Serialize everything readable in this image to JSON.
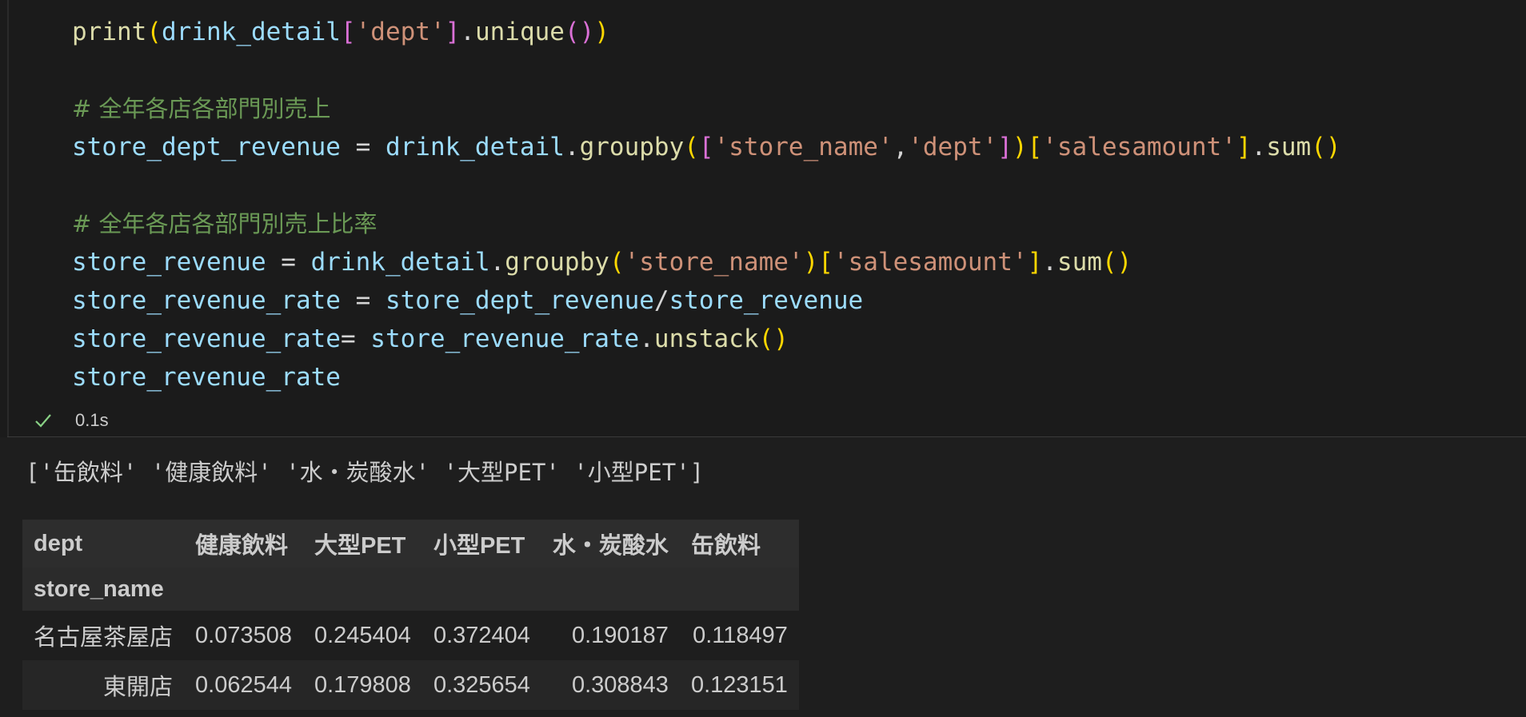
{
  "code_cell": {
    "lines": [
      {
        "segments": [
          [
            "fn",
            "print"
          ],
          [
            "b1",
            "("
          ],
          [
            "var",
            "drink_detail"
          ],
          [
            "b2",
            "["
          ],
          [
            "str",
            "'dept'"
          ],
          [
            "b2",
            "]"
          ],
          [
            "op",
            "."
          ],
          [
            "fn",
            "unique"
          ],
          [
            "b2",
            "()"
          ],
          [
            "b1",
            ")"
          ]
        ]
      },
      {
        "segments": []
      },
      {
        "segments": [
          [
            "cmt",
            "# 全年各店各部門別売上"
          ]
        ]
      },
      {
        "segments": [
          [
            "var",
            "store_dept_revenue"
          ],
          [
            "op",
            " = "
          ],
          [
            "var",
            "drink_detail"
          ],
          [
            "op",
            "."
          ],
          [
            "fn",
            "groupby"
          ],
          [
            "b1",
            "("
          ],
          [
            "b2",
            "["
          ],
          [
            "str",
            "'store_name'"
          ],
          [
            "op",
            ","
          ],
          [
            "str",
            "'dept'"
          ],
          [
            "b2",
            "]"
          ],
          [
            "b1",
            ")"
          ],
          [
            "b1",
            "["
          ],
          [
            "str",
            "'salesamount'"
          ],
          [
            "b1",
            "]"
          ],
          [
            "op",
            "."
          ],
          [
            "fn",
            "sum"
          ],
          [
            "b1",
            "()"
          ]
        ]
      },
      {
        "segments": []
      },
      {
        "segments": [
          [
            "cmt",
            "# 全年各店各部門別売上比率"
          ]
        ]
      },
      {
        "segments": [
          [
            "var",
            "store_revenue"
          ],
          [
            "op",
            " = "
          ],
          [
            "var",
            "drink_detail"
          ],
          [
            "op",
            "."
          ],
          [
            "fn",
            "groupby"
          ],
          [
            "b1",
            "("
          ],
          [
            "str",
            "'store_name'"
          ],
          [
            "b1",
            ")"
          ],
          [
            "b1",
            "["
          ],
          [
            "str",
            "'salesamount'"
          ],
          [
            "b1",
            "]"
          ],
          [
            "op",
            "."
          ],
          [
            "fn",
            "sum"
          ],
          [
            "b1",
            "()"
          ]
        ]
      },
      {
        "segments": [
          [
            "var",
            "store_revenue_rate"
          ],
          [
            "op",
            " = "
          ],
          [
            "var",
            "store_dept_revenue"
          ],
          [
            "op",
            "/"
          ],
          [
            "var",
            "store_revenue"
          ]
        ]
      },
      {
        "segments": [
          [
            "var",
            "store_revenue_rate"
          ],
          [
            "op",
            "= "
          ],
          [
            "var",
            "store_revenue_rate"
          ],
          [
            "op",
            "."
          ],
          [
            "fn",
            "unstack"
          ],
          [
            "b1",
            "()"
          ]
        ]
      },
      {
        "segments": [
          [
            "var",
            "store_revenue_rate"
          ]
        ]
      }
    ],
    "exec_time": "0.1s",
    "status_icon": "check-icon"
  },
  "output": {
    "print_text": "['缶飲料' '健康飲料' '水・炭酸水' '大型PET' '小型PET']",
    "table": {
      "columns_name": "dept",
      "columns": [
        "健康飲料",
        "大型PET",
        "小型PET",
        "水・炭酸水",
        "缶飲料"
      ],
      "index_name": "store_name",
      "rows": [
        {
          "index": "名古屋茶屋店",
          "values": [
            "0.073508",
            "0.245404",
            "0.372404",
            "0.190187",
            "0.118497"
          ]
        },
        {
          "index": "東開店",
          "values": [
            "0.062544",
            "0.179808",
            "0.325654",
            "0.308843",
            "0.123151"
          ]
        }
      ]
    }
  },
  "colors": {
    "cell_bg": "#1b1b1b",
    "function": "#dcdcaa",
    "variable": "#9cdcfe",
    "string": "#ce9178",
    "comment": "#6a9955",
    "bracket_gold": "#ffd700",
    "bracket_purple": "#da70d6",
    "success_check": "#89d185"
  }
}
